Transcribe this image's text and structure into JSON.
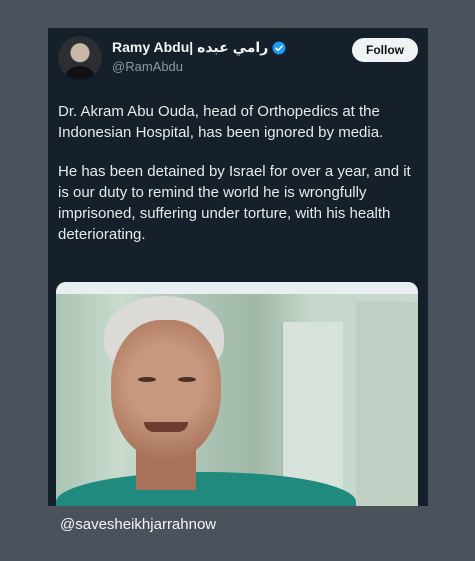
{
  "tweet": {
    "author_name": "Ramy Abdu| رامي عبده",
    "author_handle": "@RamAbdu",
    "follow_label": "Follow",
    "paragraphs": [
      "Dr. Akram Abu Ouda, head of Orthopedics at the Indonesian Hospital, has been ignored by media.",
      "He has been detained by Israel for over a year, and it is our duty to remind the world he is wrongfully imprisoned, suffering under torture, with his health deteriorating."
    ],
    "verified_icon": "verified-badge-icon",
    "verified_color": "#1d9bf0"
  },
  "caption": {
    "text": "@savesheikhjarrahnow"
  },
  "colors": {
    "page_background": "#4a525b",
    "card_background": "#15202b",
    "primary_text": "#e7e9ea",
    "secondary_text": "#8b98a5"
  }
}
